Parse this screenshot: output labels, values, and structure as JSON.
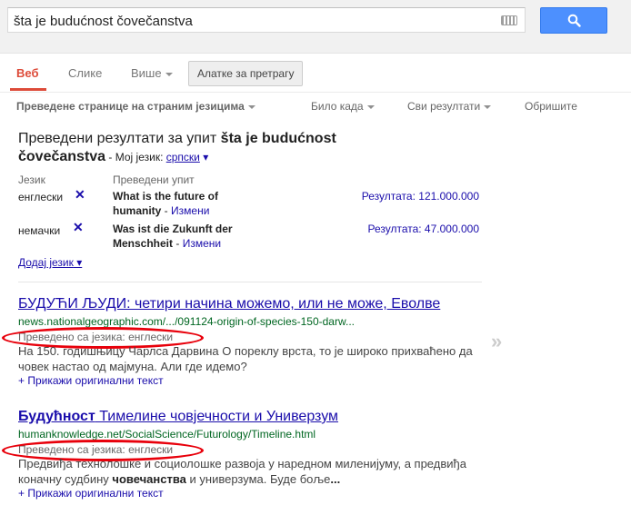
{
  "search": {
    "query": "šta je budućnost čovečanstva"
  },
  "tabs": [
    {
      "label": "Веб"
    },
    {
      "label": "Слике"
    },
    {
      "label": "Више"
    }
  ],
  "tools_button": "Алатке за претрагу",
  "subtools": {
    "translated": "Преведене странице на страним језицима",
    "any_time": "Било када",
    "all_results": "Сви резултати",
    "clear": "Обришите"
  },
  "translation": {
    "title_prefix": "Преведени резултати за упит ",
    "title_query": "šta je budućnost čovečanstva",
    "my_language_label": " - Мој језик: ",
    "my_language": "српски",
    "col_language": "Језик",
    "col_query": "Преведени упит",
    "rows": [
      {
        "lang": "енглески",
        "query": "What is the future of humanity",
        "edit": "Измени",
        "count": "Резултата: 121.000.000"
      },
      {
        "lang": "немачки",
        "query": "Was ist die Zukunft der Menschheit",
        "edit": "Измени",
        "count": "Резултата: 47.000.000"
      }
    ],
    "add_language": "Додај језик"
  },
  "results": [
    {
      "title_pre": "БУДУЋИ ЉУДИ: четири начина можемо, или не може, Еволве",
      "title_post": "",
      "url": "news.nationalgeographic.com/.../091124-origin-of-species-150-darw...",
      "note": "Преведено са језика: енглески",
      "snippet_1": "На 150. годишњицу Чарлса Дарвина О пореклу врста, то је широко прихваћено да човек настао од мајмуна. Али где идемо?",
      "snippet_bold_1": "",
      "snippet_2": "",
      "snippet_bold_2": "",
      "snippet_3": "",
      "show_original": "+ Прикажи оригинални текст"
    },
    {
      "title_pre": "Будућност",
      "title_post": " Тимелине човјечности и Универзум",
      "url": "humanknowledge.net/SocialScience/Futurology/Timeline.html",
      "note": "Преведено са језика: енглески",
      "snippet_1": "Предвиђа технолошке и социолошке развоја у наредном миленијуму, а предвиђа коначну судбину ",
      "snippet_bold_1": "човечанства",
      "snippet_2": " и универзума. Буде боље",
      "snippet_bold_2": "...",
      "snippet_3": "",
      "show_original": "+ Прикажи оригинални текст"
    }
  ],
  "colors": {
    "accent": "#dd4b39",
    "link": "#1a0dab",
    "url": "#006621",
    "search_button": "#4d90fe",
    "annotation": "#e8000b"
  }
}
